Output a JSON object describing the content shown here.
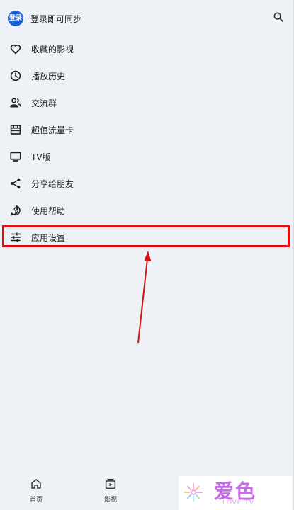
{
  "header": {
    "login_badge": "登录",
    "login_text": "登录即可同步",
    "search_icon": "search-icon"
  },
  "menu": {
    "items": [
      {
        "label": "收藏的影视",
        "icon": "heart-icon"
      },
      {
        "label": "播放历史",
        "icon": "clock-icon"
      },
      {
        "label": "交流群",
        "icon": "group-icon"
      },
      {
        "label": "超值流量卡",
        "icon": "store-icon"
      },
      {
        "label": "TV版",
        "icon": "tv-icon"
      },
      {
        "label": "分享给朋友",
        "icon": "share-icon"
      },
      {
        "label": "使用帮助",
        "icon": "help-icon"
      },
      {
        "label": "应用设置",
        "icon": "sliders-icon",
        "highlighted": true
      }
    ]
  },
  "bottom_nav": {
    "items": [
      {
        "label": "首页",
        "icon": "home-icon"
      },
      {
        "label": "影视",
        "icon": "video-icon"
      }
    ]
  },
  "watermark": {
    "main": "爱色",
    "sub": "LOVE TV"
  },
  "colors": {
    "panel_bg": "#eef1f6",
    "accent_blue": "#1a5fd6",
    "annotation_red": "#e01010",
    "watermark_purple": "#c86be8"
  }
}
